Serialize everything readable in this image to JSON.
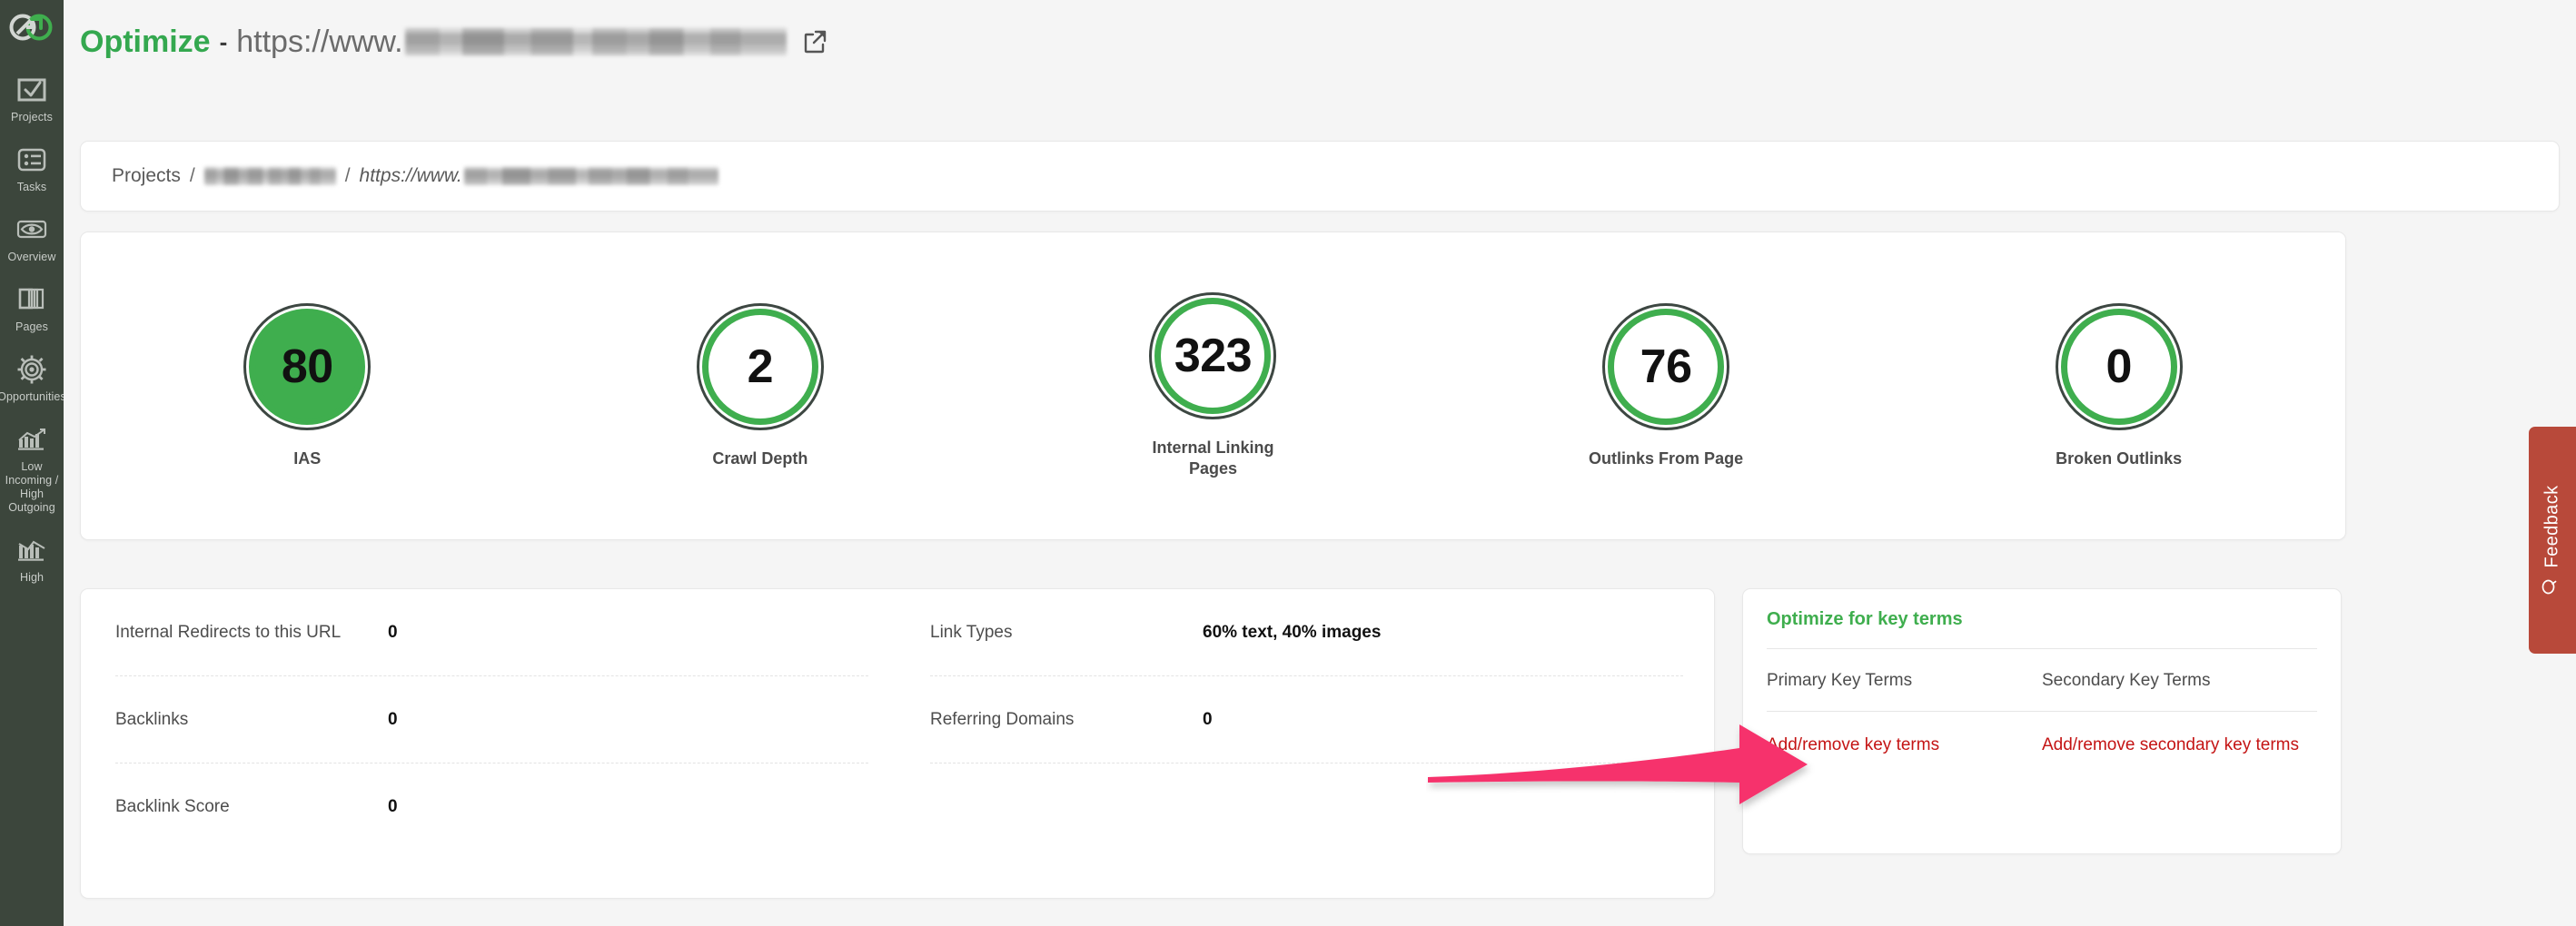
{
  "sidebar": {
    "logo_name": "infinity-link-logo",
    "items": [
      {
        "label": "Projects",
        "icon": "checkbox-check-icon"
      },
      {
        "label": "Tasks",
        "icon": "list-icon"
      },
      {
        "label": "Overview",
        "icon": "eye-icon"
      },
      {
        "label": "Pages",
        "icon": "pages-stack-icon"
      },
      {
        "label": "Opportunities",
        "icon": "gear-target-icon"
      },
      {
        "label": "Low Incoming / High Outgoing",
        "icon": "bar-chart-up-icon"
      },
      {
        "label": "High",
        "icon": "bar-chart-down-icon"
      }
    ]
  },
  "header": {
    "title_highlight": "Optimize",
    "title_dash": "-",
    "title_url_prefix": "https://www.",
    "title_url_redacted": "",
    "external_link_icon": "external-link-icon"
  },
  "breadcrumb": {
    "root": "Projects",
    "sep": "/",
    "project_redacted": "",
    "url_prefix": "https://www.",
    "url_redacted": ""
  },
  "metrics": [
    {
      "value": "80",
      "label": "IAS",
      "filled": true,
      "ring_color": "#3fae4e"
    },
    {
      "value": "2",
      "label": "Crawl Depth",
      "filled": false,
      "ring_color": "#3fae4e"
    },
    {
      "value": "323",
      "label": "Internal Linking Pages",
      "filled": false,
      "ring_color": "#3fae4e"
    },
    {
      "value": "76",
      "label": "Outlinks From Page",
      "filled": false,
      "ring_color": "#3fae4e"
    },
    {
      "value": "0",
      "label": "Broken Outlinks",
      "filled": false,
      "ring_color": "#3fae4e"
    }
  ],
  "stats": {
    "left": [
      {
        "name": "Internal Redirects to this URL",
        "value": "0"
      },
      {
        "name": "Backlinks",
        "value": "0"
      },
      {
        "name": "Backlink Score",
        "value": "0"
      }
    ],
    "right": [
      {
        "name": "Link Types",
        "value": "60% text, 40% images"
      },
      {
        "name": "Referring Domains",
        "value": "0"
      }
    ]
  },
  "key_terms": {
    "title": "Optimize for key terms",
    "primary_head": "Primary Key Terms",
    "secondary_head": "Secondary Key Terms",
    "primary_link": "Add/remove key terms",
    "secondary_link": "Add/remove secondary key terms"
  },
  "feedback": {
    "label": "Feedback",
    "icon": "speech-bubble-icon"
  },
  "annotation": {
    "name": "pink-arrow-pointing-to-add-remove-key-terms",
    "color": "#f6336c"
  },
  "colors": {
    "sidebar_bg": "#3c463c",
    "page_bg": "#f5f5f5",
    "accent_green": "#3fae4e",
    "link_red": "#c41414",
    "feedback_bg": "#b8493a",
    "ring_dark": "#3d4742"
  }
}
